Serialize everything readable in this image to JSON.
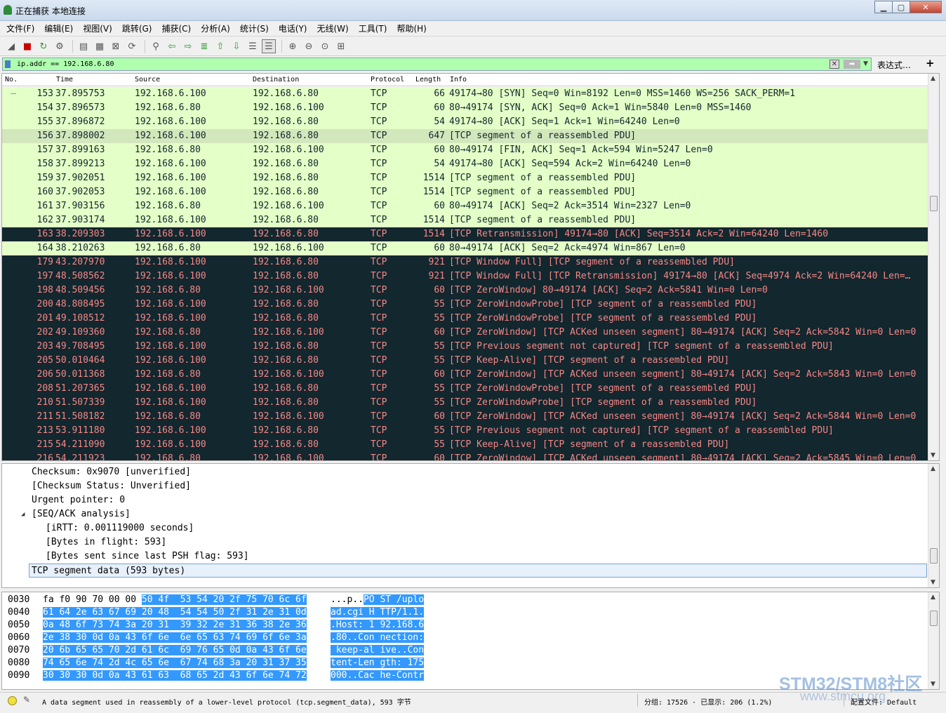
{
  "window": {
    "title": "正在捕获 本地连接",
    "controls": [
      "minimize",
      "maximize",
      "close"
    ]
  },
  "menu": [
    "文件(F)",
    "编辑(E)",
    "视图(V)",
    "跳转(G)",
    "捕获(C)",
    "分析(A)",
    "统计(S)",
    "电话(Y)",
    "无线(W)",
    "工具(T)",
    "帮助(H)"
  ],
  "toolbar": {
    "icons": [
      "start-capture-icon",
      "stop-capture-icon",
      "restart-capture-icon",
      "capture-options-icon",
      "open-file-icon",
      "save-file-icon",
      "close-file-icon",
      "reload-file-icon",
      "find-packet-icon",
      "go-back-icon",
      "go-forward-icon",
      "go-to-packet-icon",
      "go-first-icon",
      "go-last-icon",
      "auto-scroll-icon",
      "colorize-icon",
      "zoom-in-icon",
      "zoom-out-icon",
      "zoom-normal-icon",
      "resize-columns-icon"
    ]
  },
  "filter": {
    "value": "ip.addr == 192.168.6.80",
    "expression_label": "表达式…",
    "add_label": "+"
  },
  "columns": [
    "No.",
    "Time",
    "Source",
    "Destination",
    "Protocol",
    "Length",
    "Info"
  ],
  "packets": [
    {
      "no": "153",
      "time": "37.895753",
      "src": "192.168.6.100",
      "dst": "192.168.6.80",
      "proto": "TCP",
      "len": "66",
      "info": "49174→80 [SYN] Seq=0 Win=8192 Len=0 MSS=1460 WS=256 SACK_PERM=1",
      "style": "green"
    },
    {
      "no": "154",
      "time": "37.896573",
      "src": "192.168.6.80",
      "dst": "192.168.6.100",
      "proto": "TCP",
      "len": "60",
      "info": "80→49174 [SYN, ACK] Seq=0 Ack=1 Win=5840 Len=0 MSS=1460",
      "style": "green"
    },
    {
      "no": "155",
      "time": "37.896872",
      "src": "192.168.6.100",
      "dst": "192.168.6.80",
      "proto": "TCP",
      "len": "54",
      "info": "49174→80 [ACK] Seq=1 Ack=1 Win=64240 Len=0",
      "style": "green"
    },
    {
      "no": "156",
      "time": "37.898002",
      "src": "192.168.6.100",
      "dst": "192.168.6.80",
      "proto": "TCP",
      "len": "647",
      "info": "[TCP segment of a reassembled PDU]",
      "style": "sel"
    },
    {
      "no": "157",
      "time": "37.899163",
      "src": "192.168.6.80",
      "dst": "192.168.6.100",
      "proto": "TCP",
      "len": "60",
      "info": "80→49174 [FIN, ACK] Seq=1 Ack=594 Win=5247 Len=0",
      "style": "green"
    },
    {
      "no": "158",
      "time": "37.899213",
      "src": "192.168.6.100",
      "dst": "192.168.6.80",
      "proto": "TCP",
      "len": "54",
      "info": "49174→80 [ACK] Seq=594 Ack=2 Win=64240 Len=0",
      "style": "green"
    },
    {
      "no": "159",
      "time": "37.902051",
      "src": "192.168.6.100",
      "dst": "192.168.6.80",
      "proto": "TCP",
      "len": "1514",
      "info": "[TCP segment of a reassembled PDU]",
      "style": "green"
    },
    {
      "no": "160",
      "time": "37.902053",
      "src": "192.168.6.100",
      "dst": "192.168.6.80",
      "proto": "TCP",
      "len": "1514",
      "info": "[TCP segment of a reassembled PDU]",
      "style": "green"
    },
    {
      "no": "161",
      "time": "37.903156",
      "src": "192.168.6.80",
      "dst": "192.168.6.100",
      "proto": "TCP",
      "len": "60",
      "info": "80→49174 [ACK] Seq=2 Ack=3514 Win=2327 Len=0",
      "style": "green"
    },
    {
      "no": "162",
      "time": "37.903174",
      "src": "192.168.6.100",
      "dst": "192.168.6.80",
      "proto": "TCP",
      "len": "1514",
      "info": "[TCP segment of a reassembled PDU]",
      "style": "green"
    },
    {
      "no": "163",
      "time": "38.209303",
      "src": "192.168.6.100",
      "dst": "192.168.6.80",
      "proto": "TCP",
      "len": "1514",
      "info": "[TCP Retransmission] 49174→80 [ACK] Seq=3514 Ack=2 Win=64240 Len=1460",
      "style": "bad"
    },
    {
      "no": "164",
      "time": "38.210263",
      "src": "192.168.6.80",
      "dst": "192.168.6.100",
      "proto": "TCP",
      "len": "60",
      "info": "80→49174 [ACK] Seq=2 Ack=4974 Win=867 Len=0",
      "style": "green"
    },
    {
      "no": "179",
      "time": "43.207970",
      "src": "192.168.6.100",
      "dst": "192.168.6.80",
      "proto": "TCP",
      "len": "921",
      "info": "[TCP Window Full] [TCP segment of a reassembled PDU]",
      "style": "bad"
    },
    {
      "no": "197",
      "time": "48.508562",
      "src": "192.168.6.100",
      "dst": "192.168.6.80",
      "proto": "TCP",
      "len": "921",
      "info": "[TCP Window Full] [TCP Retransmission] 49174→80 [ACK] Seq=4974 Ack=2 Win=64240 Len=…",
      "style": "bad"
    },
    {
      "no": "198",
      "time": "48.509456",
      "src": "192.168.6.80",
      "dst": "192.168.6.100",
      "proto": "TCP",
      "len": "60",
      "info": "[TCP ZeroWindow] 80→49174 [ACK] Seq=2 Ack=5841 Win=0 Len=0",
      "style": "bad"
    },
    {
      "no": "200",
      "time": "48.808495",
      "src": "192.168.6.100",
      "dst": "192.168.6.80",
      "proto": "TCP",
      "len": "55",
      "info": "[TCP ZeroWindowProbe] [TCP segment of a reassembled PDU]",
      "style": "bad"
    },
    {
      "no": "201",
      "time": "49.108512",
      "src": "192.168.6.100",
      "dst": "192.168.6.80",
      "proto": "TCP",
      "len": "55",
      "info": "[TCP ZeroWindowProbe] [TCP segment of a reassembled PDU]",
      "style": "bad"
    },
    {
      "no": "202",
      "time": "49.109360",
      "src": "192.168.6.80",
      "dst": "192.168.6.100",
      "proto": "TCP",
      "len": "60",
      "info": "[TCP ZeroWindow] [TCP ACKed unseen segment] 80→49174 [ACK] Seq=2 Ack=5842 Win=0 Len=0",
      "style": "bad"
    },
    {
      "no": "203",
      "time": "49.708495",
      "src": "192.168.6.100",
      "dst": "192.168.6.80",
      "proto": "TCP",
      "len": "55",
      "info": "[TCP Previous segment not captured] [TCP segment of a reassembled PDU]",
      "style": "bad"
    },
    {
      "no": "205",
      "time": "50.010464",
      "src": "192.168.6.100",
      "dst": "192.168.6.80",
      "proto": "TCP",
      "len": "55",
      "info": "[TCP Keep-Alive] [TCP segment of a reassembled PDU]",
      "style": "bad"
    },
    {
      "no": "206",
      "time": "50.011368",
      "src": "192.168.6.80",
      "dst": "192.168.6.100",
      "proto": "TCP",
      "len": "60",
      "info": "[TCP ZeroWindow] [TCP ACKed unseen segment] 80→49174 [ACK] Seq=2 Ack=5843 Win=0 Len=0",
      "style": "bad"
    },
    {
      "no": "208",
      "time": "51.207365",
      "src": "192.168.6.100",
      "dst": "192.168.6.80",
      "proto": "TCP",
      "len": "55",
      "info": "[TCP ZeroWindowProbe] [TCP segment of a reassembled PDU]",
      "style": "bad"
    },
    {
      "no": "210",
      "time": "51.507339",
      "src": "192.168.6.100",
      "dst": "192.168.6.80",
      "proto": "TCP",
      "len": "55",
      "info": "[TCP ZeroWindowProbe] [TCP segment of a reassembled PDU]",
      "style": "bad"
    },
    {
      "no": "211",
      "time": "51.508182",
      "src": "192.168.6.80",
      "dst": "192.168.6.100",
      "proto": "TCP",
      "len": "60",
      "info": "[TCP ZeroWindow] [TCP ACKed unseen segment] 80→49174 [ACK] Seq=2 Ack=5844 Win=0 Len=0",
      "style": "bad"
    },
    {
      "no": "213",
      "time": "53.911180",
      "src": "192.168.6.100",
      "dst": "192.168.6.80",
      "proto": "TCP",
      "len": "55",
      "info": "[TCP Previous segment not captured] [TCP segment of a reassembled PDU]",
      "style": "bad"
    },
    {
      "no": "215",
      "time": "54.211090",
      "src": "192.168.6.100",
      "dst": "192.168.6.80",
      "proto": "TCP",
      "len": "55",
      "info": "[TCP Keep-Alive] [TCP segment of a reassembled PDU]",
      "style": "bad"
    },
    {
      "no": "216",
      "time": "54.211923",
      "src": "192.168.6.80",
      "dst": "192.168.6.100",
      "proto": "TCP",
      "len": "60",
      "info": "[TCP ZeroWindow] [TCP ACKed unseen segment] 80→49174 [ACK] Seq=2 Ack=5845 Win=0 Len=0",
      "style": "bad"
    }
  ],
  "details": [
    {
      "text": "Checksum: 0x9070 [unverified]",
      "indent": 1,
      "expander": "",
      "selected": false
    },
    {
      "text": "[Checksum Status: Unverified]",
      "indent": 1,
      "expander": "",
      "selected": false
    },
    {
      "text": "Urgent pointer: 0",
      "indent": 1,
      "expander": "",
      "selected": false
    },
    {
      "text": "[SEQ/ACK analysis]",
      "indent": 1,
      "expander": "◢",
      "selected": false
    },
    {
      "text": "[iRTT: 0.001119000 seconds]",
      "indent": 2,
      "expander": "",
      "selected": false
    },
    {
      "text": "[Bytes in flight: 593]",
      "indent": 2,
      "expander": "",
      "selected": false
    },
    {
      "text": "[Bytes sent since last PSH flag: 593]",
      "indent": 2,
      "expander": "",
      "selected": false
    },
    {
      "text": "TCP segment data (593 bytes)",
      "indent": 1,
      "expander": "",
      "selected": true
    }
  ],
  "bytes": [
    {
      "offset": "0030",
      "hex_pre": "fa f0 90 70 00 00 ",
      "hex_hl": "50 4f  53 54 20 2f 75 70 6c 6f",
      "ascii_pre": "...p..",
      "ascii_hl": "PO ST /uplo"
    },
    {
      "offset": "0040",
      "hex_pre": "",
      "hex_hl": "61 64 2e 63 67 69 20 48  54 54 50 2f 31 2e 31 0d",
      "ascii_pre": "",
      "ascii_hl": "ad.cgi H TTP/1.1."
    },
    {
      "offset": "0050",
      "hex_pre": "",
      "hex_hl": "0a 48 6f 73 74 3a 20 31  39 32 2e 31 36 38 2e 36",
      "ascii_pre": "",
      "ascii_hl": ".Host: 1 92.168.6"
    },
    {
      "offset": "0060",
      "hex_pre": "",
      "hex_hl": "2e 38 30 0d 0a 43 6f 6e  6e 65 63 74 69 6f 6e 3a",
      "ascii_pre": "",
      "ascii_hl": ".80..Con nection:"
    },
    {
      "offset": "0070",
      "hex_pre": "",
      "hex_hl": "20 6b 65 65 70 2d 61 6c  69 76 65 0d 0a 43 6f 6e",
      "ascii_pre": "",
      "ascii_hl": " keep-al ive..Con"
    },
    {
      "offset": "0080",
      "hex_pre": "",
      "hex_hl": "74 65 6e 74 2d 4c 65 6e  67 74 68 3a 20 31 37 35",
      "ascii_pre": "",
      "ascii_hl": "tent-Len gth: 175"
    },
    {
      "offset": "0090",
      "hex_pre": "",
      "hex_hl": "30 30 30 0d 0a 43 61 63  68 65 2d 43 6f 6e 74 72",
      "ascii_pre": "",
      "ascii_hl": "000..Cac he-Contr"
    }
  ],
  "status": {
    "message": "A data segment used in reassembly of a lower-level protocol (tcp.segment_data), 593 字节",
    "stats": "分组: 17526 · 已显示: 206 (1.2%)",
    "profile": "配置文件: Default"
  },
  "watermark": {
    "brand": "STM32/STM8社区",
    "url": "www.stmcu.org"
  },
  "colors": {
    "good_row_bg": "#e4ffc7",
    "bad_row_bg": "#12272e",
    "bad_row_fg": "#f78787",
    "filter_valid_bg": "#afffaf",
    "byte_highlight": "#3399ff"
  }
}
